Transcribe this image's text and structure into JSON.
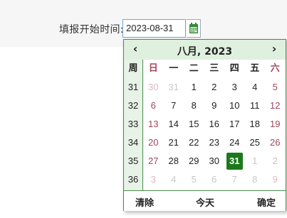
{
  "form": {
    "label": "填报开始时间:",
    "value": "2023-08-31"
  },
  "datepicker": {
    "prev": "‹",
    "next": "›",
    "title": "八月, 2023",
    "week_header": "周",
    "weekdays": [
      "日",
      "一",
      "二",
      "三",
      "四",
      "五",
      "六"
    ],
    "weeks": [
      "31",
      "32",
      "33",
      "34",
      "35",
      "36"
    ],
    "days": [
      [
        "30",
        "31",
        "1",
        "2",
        "3",
        "4",
        "5"
      ],
      [
        "6",
        "7",
        "8",
        "9",
        "10",
        "11",
        "12"
      ],
      [
        "13",
        "14",
        "15",
        "16",
        "17",
        "18",
        "19"
      ],
      [
        "20",
        "21",
        "22",
        "23",
        "24",
        "25",
        "26"
      ],
      [
        "27",
        "28",
        "29",
        "30",
        "31",
        "1",
        "2"
      ],
      [
        "3",
        "4",
        "5",
        "6",
        "7",
        "8",
        "9"
      ]
    ],
    "selected": "31",
    "footer": {
      "clear": "清除",
      "today": "今天",
      "ok": "确定"
    },
    "colors": {
      "accent": "#1a7a1a",
      "header_bg": "#dff0df",
      "weekend": "#a0465a"
    }
  }
}
